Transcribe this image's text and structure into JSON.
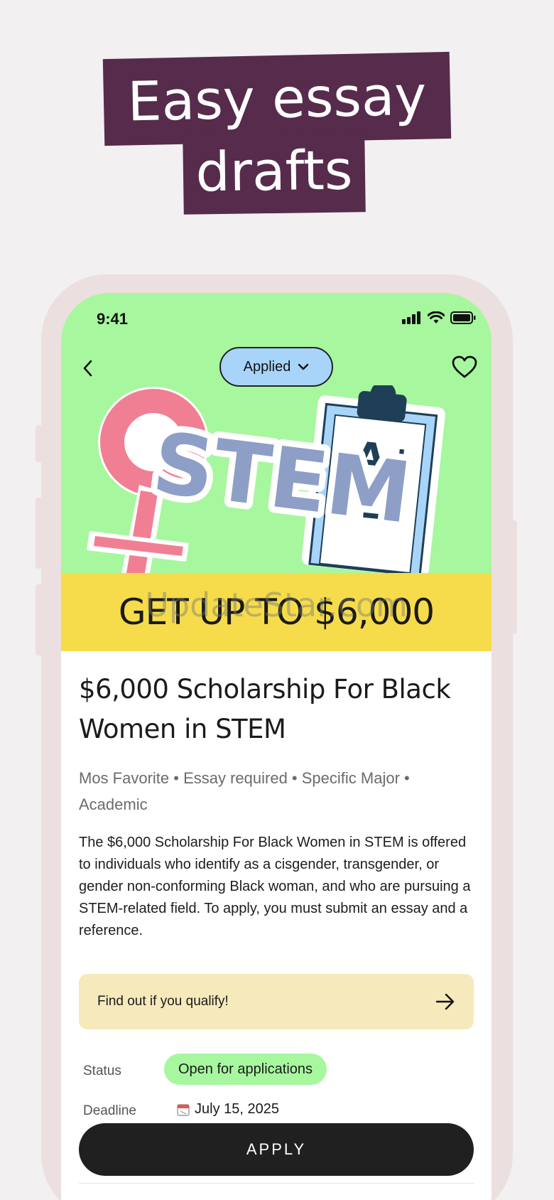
{
  "headline": {
    "line1": "Easy essay",
    "line2": "drafts"
  },
  "status_bar": {
    "time": "9:41"
  },
  "nav": {
    "status_pill_label": "Applied"
  },
  "hero": {
    "art_word": "STEM",
    "grade": "A+",
    "banner": "GET UP TO $6,000",
    "watermark": "UpdateStar.com"
  },
  "scholarship": {
    "title": "$6,000 Scholarship For Black Women in STEM",
    "tags": "Mos Favorite • Essay required • Specific Major • Academic",
    "description": "The $6,000 Scholarship For Black Women in STEM is offered to individuals who identify as a cisgender, transgender, or gender non-conforming Black woman, and who are pursuing a STEM-related field. To apply, you must submit an essay and a reference.",
    "qualify_cta": "Find out if you qualify!",
    "status_label": "Status",
    "status_value": "Open for applications",
    "deadline_label": "Deadline",
    "deadline_value": "July 15, 2025",
    "apply_label": "APPLY"
  },
  "colors": {
    "headline_bg": "#572b4c",
    "hero_bg": "#a7f79f",
    "banner_bg": "#f6dc4a",
    "pill_bg": "#a8d4f9",
    "qualify_bg": "#f6eabc",
    "apply_bg": "#202020"
  },
  "icons": [
    "back-chevron-icon",
    "chevron-down-icon",
    "heart-icon",
    "arrow-right-icon",
    "calendar-icon",
    "signal-icon",
    "wifi-icon",
    "battery-icon"
  ]
}
